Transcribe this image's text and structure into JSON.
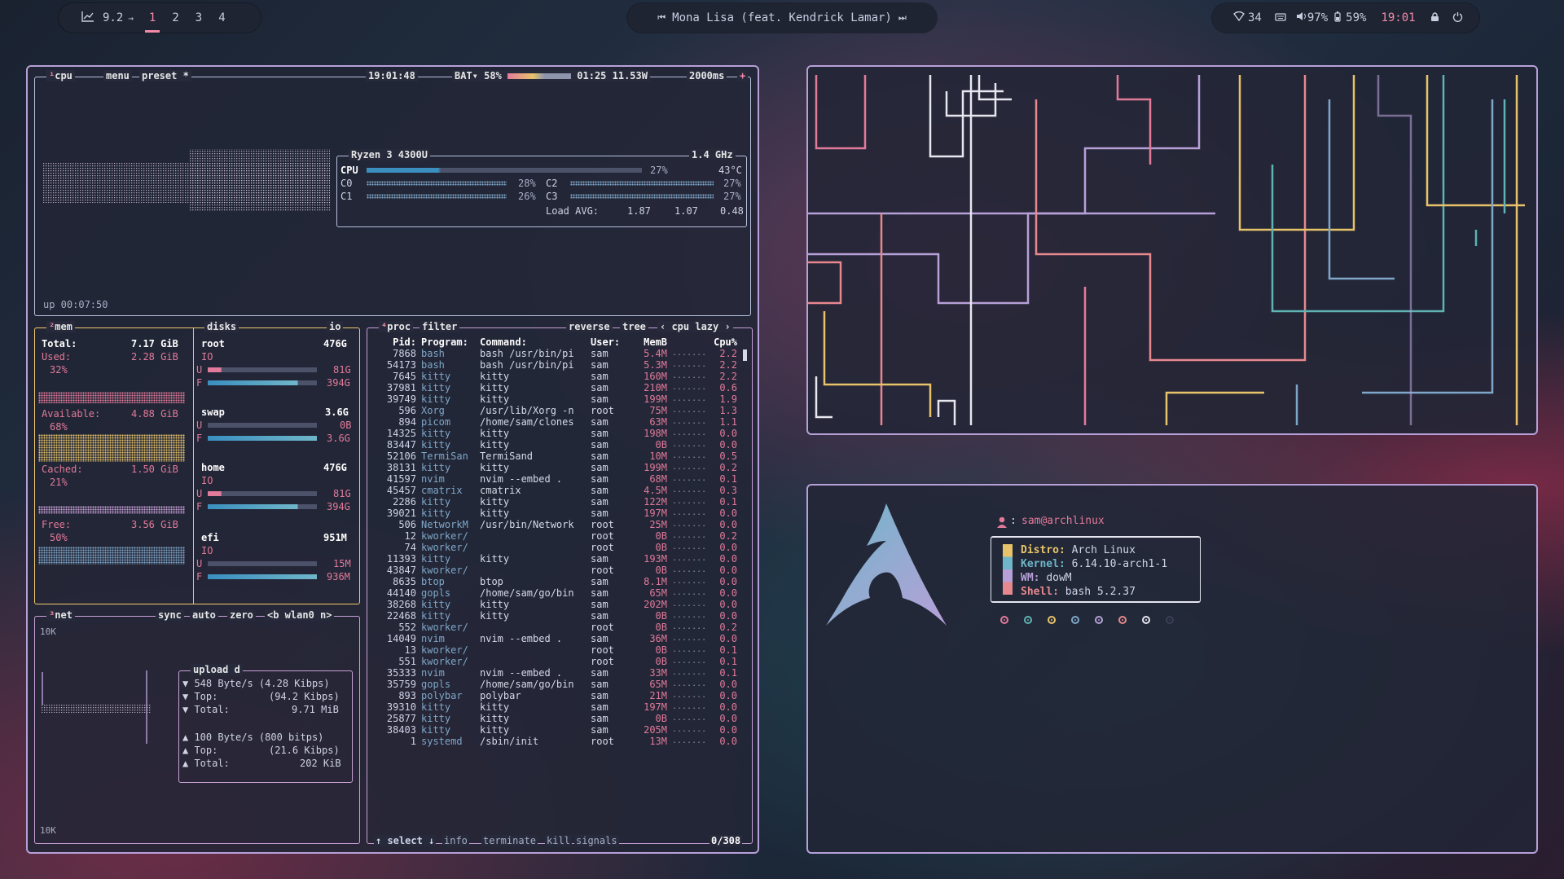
{
  "topbar": {
    "left": {
      "load": "9.2",
      "arrow": "→",
      "workspaces": [
        "1",
        "2",
        "3",
        "4"
      ],
      "active_workspace": "1"
    },
    "center": {
      "prev": "⏮",
      "track": "Mona Lisa (feat. Kendrick Lamar)",
      "next": "⏭"
    },
    "right": {
      "wifi": "34",
      "volume": "97%",
      "battery": "59%",
      "time": "19:01"
    }
  },
  "btop": {
    "cpu_box": {
      "title_num": "¹",
      "title": "cpu",
      "menu": "menu",
      "preset": "preset *",
      "clock": "19:01:48",
      "bat_label": "BAT▾ 58%",
      "bat_time": "01:25 11.53W",
      "interval": "2000ms",
      "plus": "+",
      "model": "Ryzen 3 4300U",
      "freq": "1.4 GHz",
      "cpu_label": "CPU",
      "cpu_pct": "27%",
      "temp": "43°C",
      "cores": [
        {
          "name": "C0",
          "pct": "28%"
        },
        {
          "name": "C2",
          "pct": "27%"
        },
        {
          "name": "C1",
          "pct": "26%"
        },
        {
          "name": "C3",
          "pct": "27%"
        }
      ],
      "load_label": "Load AVG:",
      "load": [
        "1.87",
        "1.07",
        "0.48"
      ],
      "uptime": "up 00:07:50"
    },
    "mem_box": {
      "title_num": "²",
      "title": "mem",
      "total_label": "Total:",
      "total": "7.17 GiB",
      "used_label": "Used:",
      "used": "2.28 GiB",
      "used_pct": "32%",
      "avail_label": "Available:",
      "avail": "4.88 GiB",
      "avail_pct": "68%",
      "cached_label": "Cached:",
      "cached": "1.50 GiB",
      "cached_pct": "21%",
      "free_label": "Free:",
      "free": "3.56 GiB",
      "free_pct": "50%"
    },
    "disks_box": {
      "title": "disks",
      "io": "io",
      "disks": [
        {
          "name": "root",
          "size": "476G",
          "io": "IO",
          "u_label": "U",
          "u": "81G",
          "f_label": "F",
          "f": "394G",
          "used_frac": 0.17
        },
        {
          "name": "swap",
          "size": "3.6G",
          "io": "",
          "u_label": "U",
          "u": "0B",
          "f_label": "F",
          "f": "3.6G",
          "used_frac": 0.0
        },
        {
          "name": "home",
          "size": "476G",
          "io": "IO",
          "u_label": "U",
          "u": "81G",
          "f_label": "F",
          "f": "394G",
          "used_frac": 0.17
        },
        {
          "name": "efi",
          "size": "951M",
          "io": "IO",
          "u_label": "U",
          "u": "15M",
          "f_label": "F",
          "f": "936M",
          "used_frac": 0.02
        }
      ]
    },
    "net_box": {
      "title_num": "³",
      "title": "net",
      "sync": "sync",
      "auto": "auto",
      "zero": "zero",
      "iface": "<b wlan0 n>",
      "top_scale": "10K",
      "bottom_scale": "10K",
      "sub_title": "upload",
      "sub_d": "d",
      "down_rate": "▼ 548 Byte/s (4.28 Kibps)",
      "down_top": "▼ Top:",
      "down_top_val": "(94.2 Kibps)",
      "down_total": "▼ Total:",
      "down_total_val": "9.71 MiB",
      "up_rate": "▲ 100 Byte/s  (800 bitps)",
      "up_top": "▲ Top:",
      "up_top_val": "(21.6 Kibps)",
      "up_total": "▲ Total:",
      "up_total_val": "202 KiB"
    },
    "proc_box": {
      "title_num": "⁴",
      "title": "proc",
      "filter": "filter",
      "reverse": "reverse",
      "tree": "tree",
      "sort": "‹ cpu lazy ›",
      "headers": {
        "pid": "Pid:",
        "program": "Program:",
        "command": "Command:",
        "user": "User:",
        "mem": "MemB",
        "cpu": "Cpu%"
      },
      "rows": [
        [
          "7868",
          "bash",
          "bash /usr/bin/pi",
          "sam",
          "5.4M",
          "2.2"
        ],
        [
          "54173",
          "bash",
          "bash /usr/bin/pi",
          "sam",
          "5.3M",
          "2.2"
        ],
        [
          "7645",
          "kitty",
          "kitty",
          "sam",
          "160M",
          "2.2"
        ],
        [
          "37981",
          "kitty",
          "kitty",
          "sam",
          "210M",
          "0.6"
        ],
        [
          "39749",
          "kitty",
          "kitty",
          "sam",
          "199M",
          "1.9"
        ],
        [
          "596",
          "Xorg",
          "/usr/lib/Xorg -n",
          "root",
          "75M",
          "1.3"
        ],
        [
          "894",
          "picom",
          "/home/sam/clones",
          "sam",
          "63M",
          "1.1"
        ],
        [
          "14325",
          "kitty",
          "kitty",
          "sam",
          "198M",
          "0.0"
        ],
        [
          "83447",
          "kitty",
          "kitty",
          "sam",
          "0B",
          "0.0"
        ],
        [
          "52106",
          "TermiSan",
          "TermiSand",
          "sam",
          "10M",
          "0.5"
        ],
        [
          "38131",
          "kitty",
          "kitty",
          "sam",
          "199M",
          "0.2"
        ],
        [
          "41597",
          "nvim",
          "nvim --embed .",
          "sam",
          "68M",
          "0.1"
        ],
        [
          "45457",
          "cmatrix",
          "cmatrix",
          "sam",
          "4.5M",
          "0.3"
        ],
        [
          "2286",
          "kitty",
          "kitty",
          "sam",
          "122M",
          "0.1"
        ],
        [
          "39021",
          "kitty",
          "kitty",
          "sam",
          "197M",
          "0.0"
        ],
        [
          "506",
          "NetworkM",
          "/usr/bin/Network",
          "root",
          "25M",
          "0.0"
        ],
        [
          "12",
          "kworker/",
          "",
          "root",
          "0B",
          "0.2"
        ],
        [
          "74",
          "kworker/",
          "",
          "root",
          "0B",
          "0.0"
        ],
        [
          "11393",
          "kitty",
          "kitty",
          "sam",
          "193M",
          "0.0"
        ],
        [
          "43847",
          "kworker/",
          "",
          "root",
          "0B",
          "0.0"
        ],
        [
          "8635",
          "btop",
          "btop",
          "sam",
          "8.1M",
          "0.0"
        ],
        [
          "44140",
          "gopls",
          "/home/sam/go/bin",
          "sam",
          "65M",
          "0.0"
        ],
        [
          "38268",
          "kitty",
          "kitty",
          "sam",
          "202M",
          "0.0"
        ],
        [
          "22468",
          "kitty",
          "kitty",
          "sam",
          "0B",
          "0.0"
        ],
        [
          "552",
          "kworker/",
          "",
          "root",
          "0B",
          "0.2"
        ],
        [
          "14049",
          "nvim",
          "nvim --embed .",
          "sam",
          "36M",
          "0.0"
        ],
        [
          "13",
          "kworker/",
          "",
          "root",
          "0B",
          "0.1"
        ],
        [
          "551",
          "kworker/",
          "",
          "root",
          "0B",
          "0.1"
        ],
        [
          "35333",
          "nvim",
          "nvim --embed .",
          "sam",
          "33M",
          "0.1"
        ],
        [
          "35759",
          "gopls",
          "/home/sam/go/bin",
          "sam",
          "65M",
          "0.0"
        ],
        [
          "893",
          "polybar",
          "polybar",
          "sam",
          "21M",
          "0.0"
        ],
        [
          "39310",
          "kitty",
          "kitty",
          "sam",
          "197M",
          "0.0"
        ],
        [
          "25877",
          "kitty",
          "kitty",
          "sam",
          "0B",
          "0.0"
        ],
        [
          "38403",
          "kitty",
          "kitty",
          "sam",
          "205M",
          "0.0"
        ],
        [
          "1",
          "systemd",
          "/sbin/init",
          "root",
          "13M",
          "0.0"
        ]
      ],
      "footer": {
        "select": "↑ select ↓",
        "info": "info",
        "terminate": "terminate",
        "kill": "kill",
        "signals": "signals",
        "count": "0/308"
      }
    }
  },
  "fetch": {
    "user_icon": "user-icon",
    "user": "sam@archlinux",
    "distro_label": "Distro:",
    "distro": "Arch Linux",
    "kernel_label": "Kernel:",
    "kernel": "6.14.10-arch1-1",
    "wm_label": "WM:",
    "wm": "dowM",
    "shell_label": "Shell:",
    "shell": "bash 5.2.37",
    "colors": [
      "#e27a9a",
      "#5fb3b3",
      "#e8c36a",
      "#7fa7c9",
      "#b7a0d8",
      "#e7888f",
      "#e6e6f0",
      "#3b3f55"
    ]
  },
  "theme": {
    "accent": "#f38ba8",
    "border": "#b7a0d8",
    "bg": "#22263a"
  }
}
